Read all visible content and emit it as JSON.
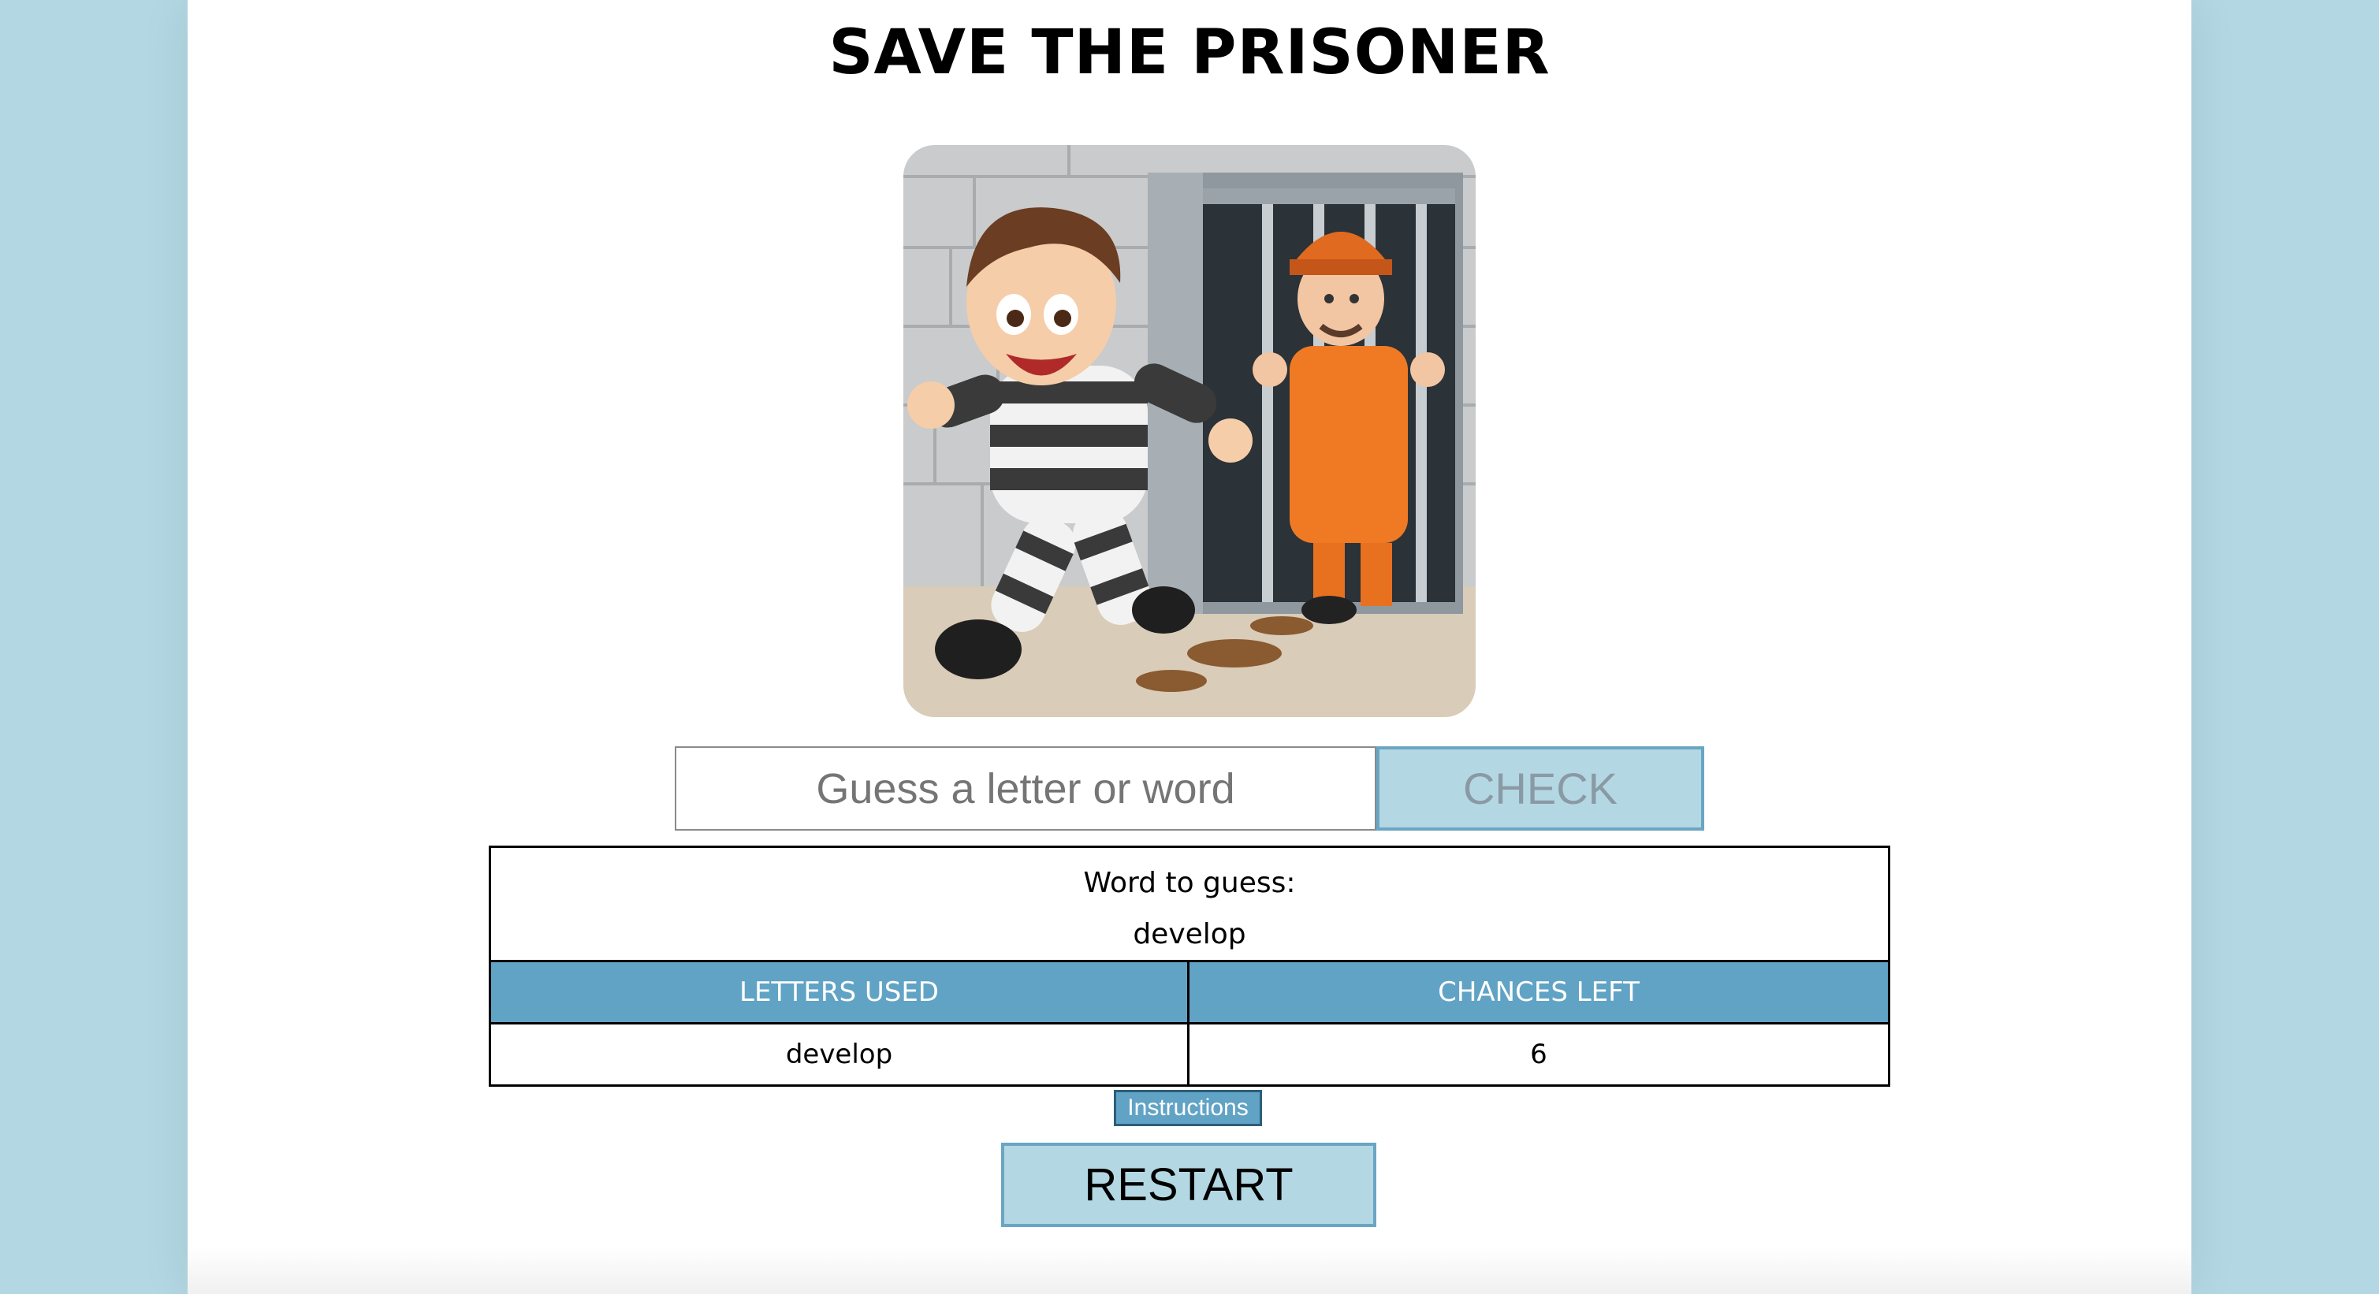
{
  "game": {
    "title": "SAVE THE PRISONER"
  },
  "guess": {
    "placeholder": "Guess a letter or word",
    "value": "",
    "check_label": "CHECK"
  },
  "board": {
    "word_label": "Word to guess:",
    "word_value": "develop",
    "letters_used_header": "LETTERS USED",
    "chances_left_header": "CHANCES LEFT",
    "letters_used_value": "develop",
    "chances_left_value": "6"
  },
  "buttons": {
    "instructions_label": "Instructions",
    "restart_label": "RESTART"
  },
  "colors": {
    "background": "#b3d8e3",
    "table_header": "#61a3c5",
    "button_fill": "#b3d8e3",
    "button_border": "#6aa5c4"
  }
}
